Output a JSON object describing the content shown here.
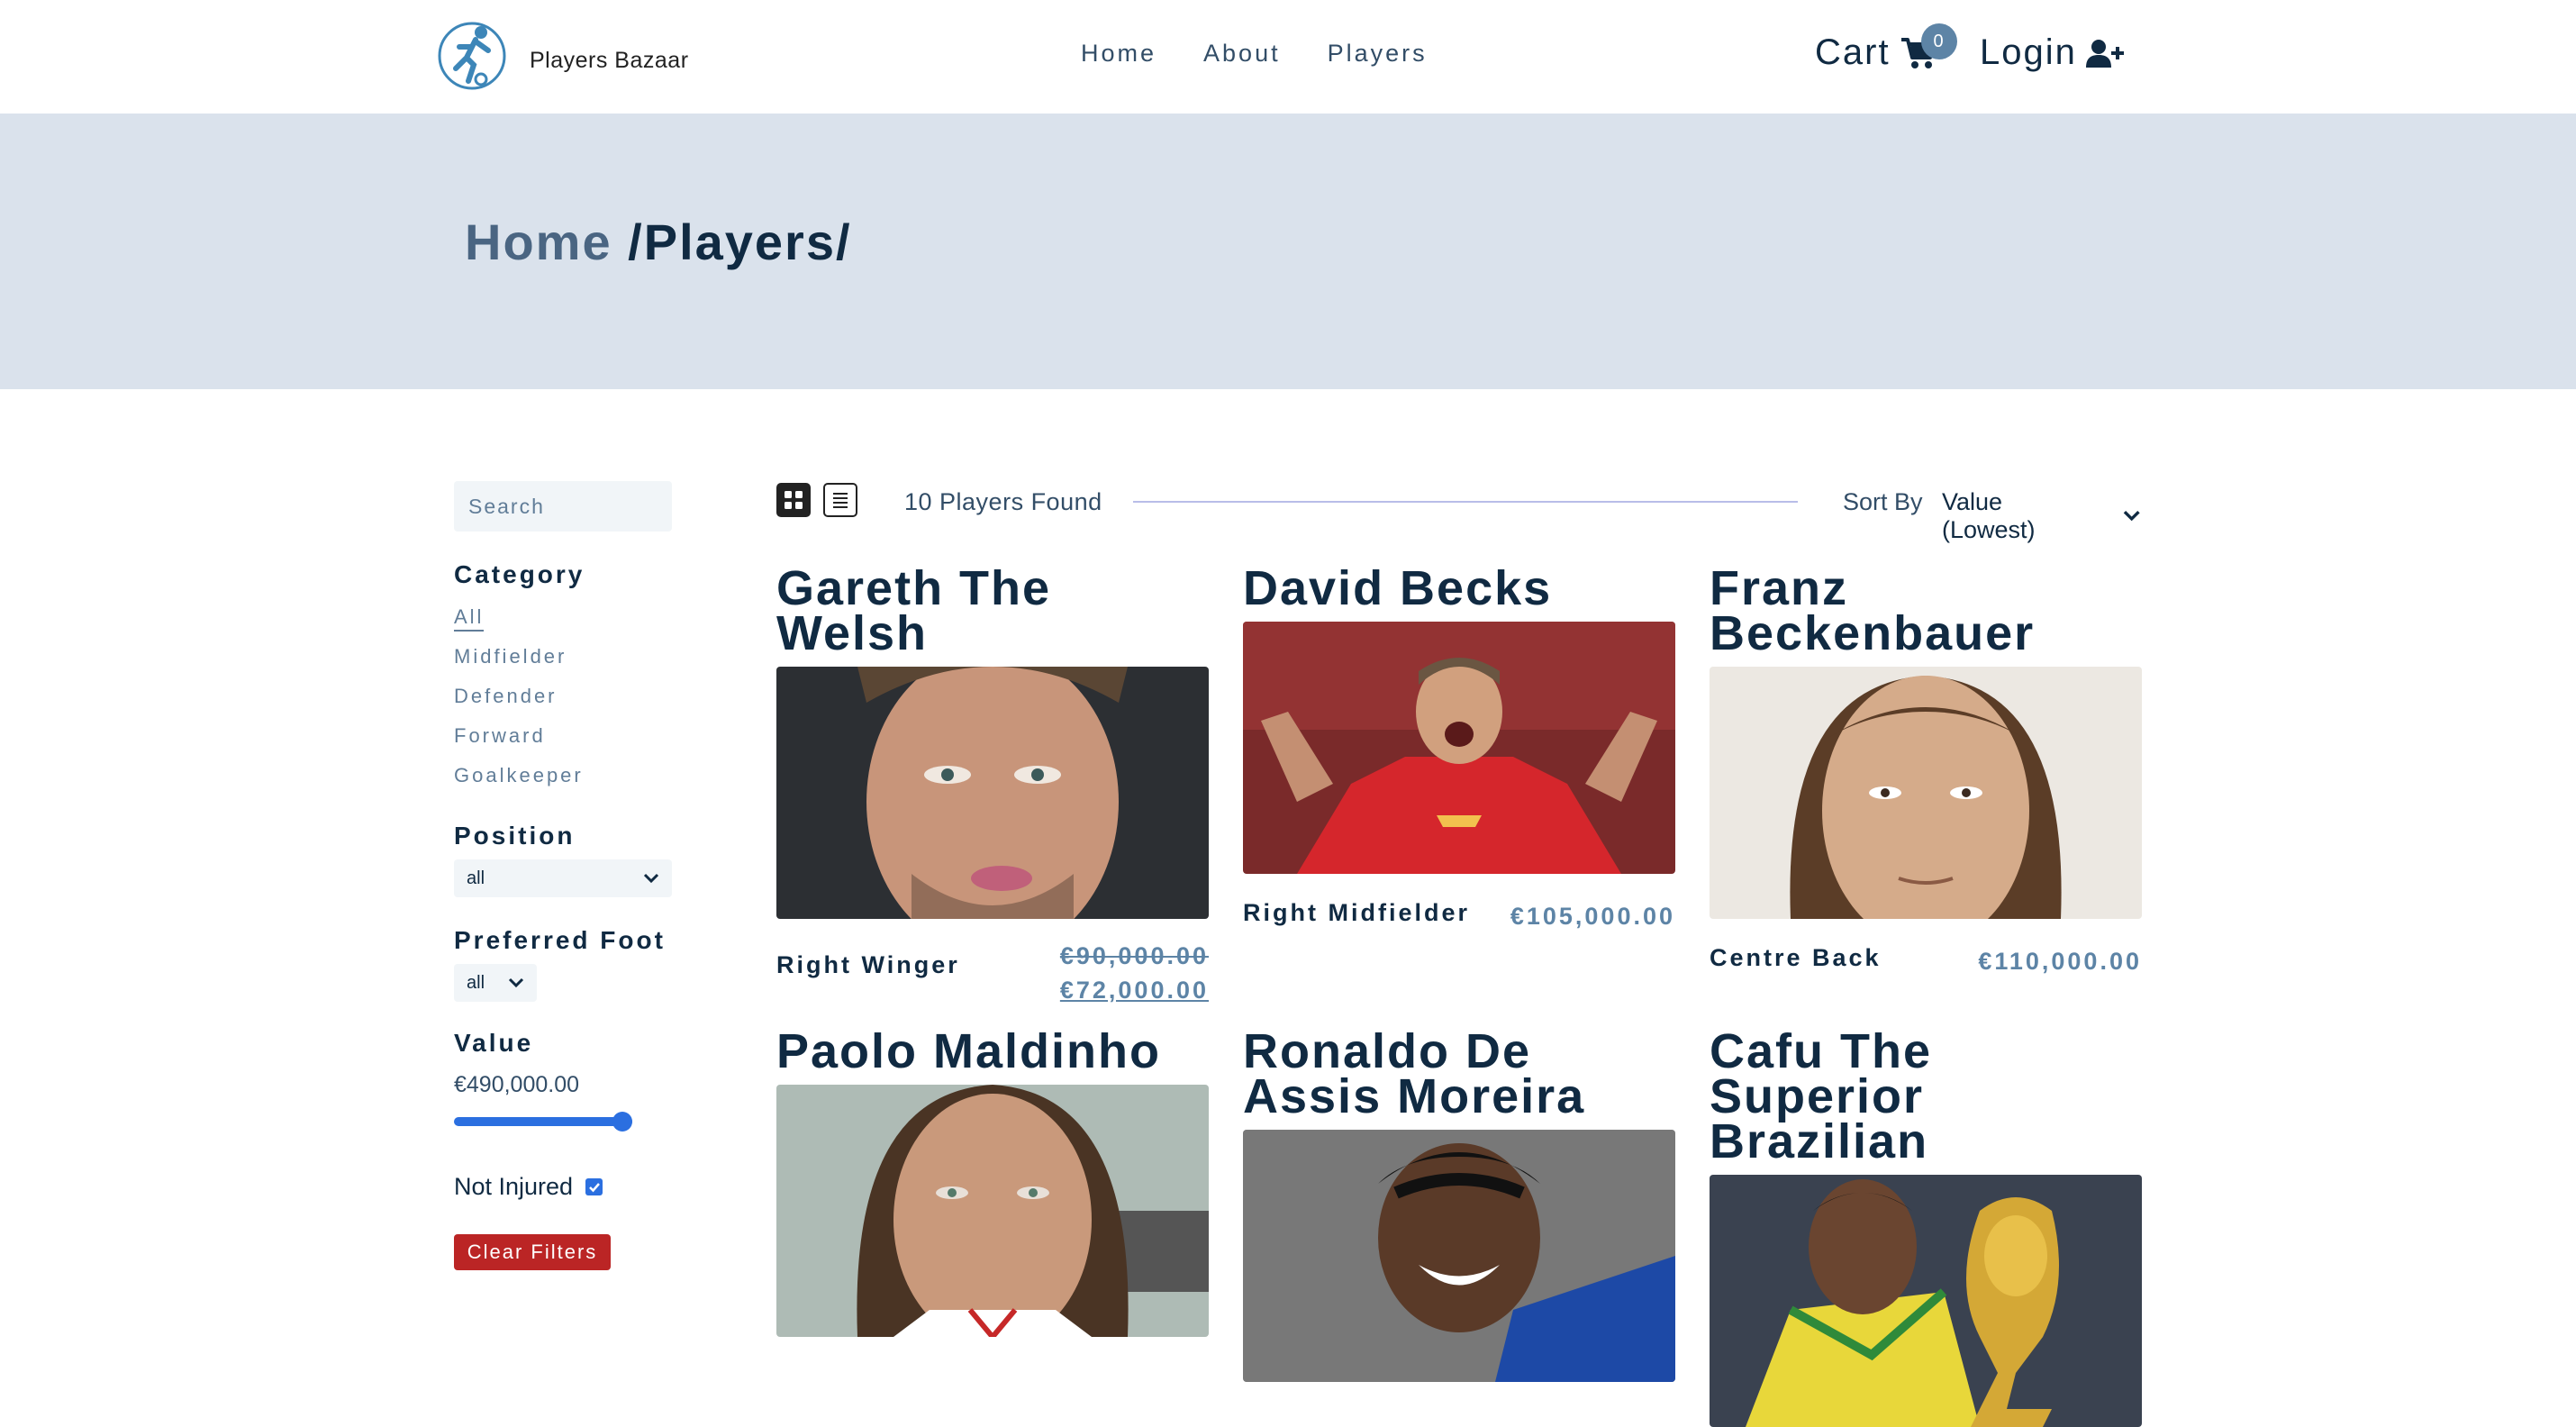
{
  "brand": {
    "name": "Players Bazaar"
  },
  "nav": {
    "links": [
      "Home",
      "About",
      "Players"
    ],
    "cart_label": "Cart",
    "cart_count": "0",
    "login_label": "Login"
  },
  "hero": {
    "crumb_home": "Home",
    "crumb_rest": " /Players/"
  },
  "filters": {
    "search_placeholder": "Search",
    "category_title": "Category",
    "categories": [
      "All",
      "Midfielder",
      "Defender",
      "Forward",
      "Goalkeeper"
    ],
    "active_category": "All",
    "position_title": "Position",
    "position_value": "all",
    "foot_title": "Preferred Foot",
    "foot_value": "all",
    "value_title": "Value",
    "value_amount": "€490,000.00",
    "value_slider_fraction": 1.0,
    "injured_label": "Not Injured",
    "injured_checked": true,
    "clear_label": "Clear Filters"
  },
  "toolbar": {
    "found_text": "10 Players Found",
    "sort_label": "Sort By",
    "sort_value": "Value (Lowest)"
  },
  "players": [
    {
      "name": "Gareth The Welsh",
      "position": "Right Winger",
      "old_price": "€90,000.00",
      "price": "€72,000.00"
    },
    {
      "name": "David Becks",
      "position": "Right Midfielder",
      "price": "€105,000.00"
    },
    {
      "name": "Franz Beckenbauer",
      "position": "Centre Back",
      "price": "€110,000.00"
    },
    {
      "name": "Paolo Maldinho"
    },
    {
      "name": "Ronaldo De Assis Moreira"
    },
    {
      "name": "Cafu The Superior Brazilian"
    }
  ],
  "colors": {
    "accent": "#5d84a6",
    "hero_bg": "#dae2ec",
    "danger": "#bb2525",
    "primary_text": "#102a42",
    "control_blue": "#2b6fe0"
  }
}
